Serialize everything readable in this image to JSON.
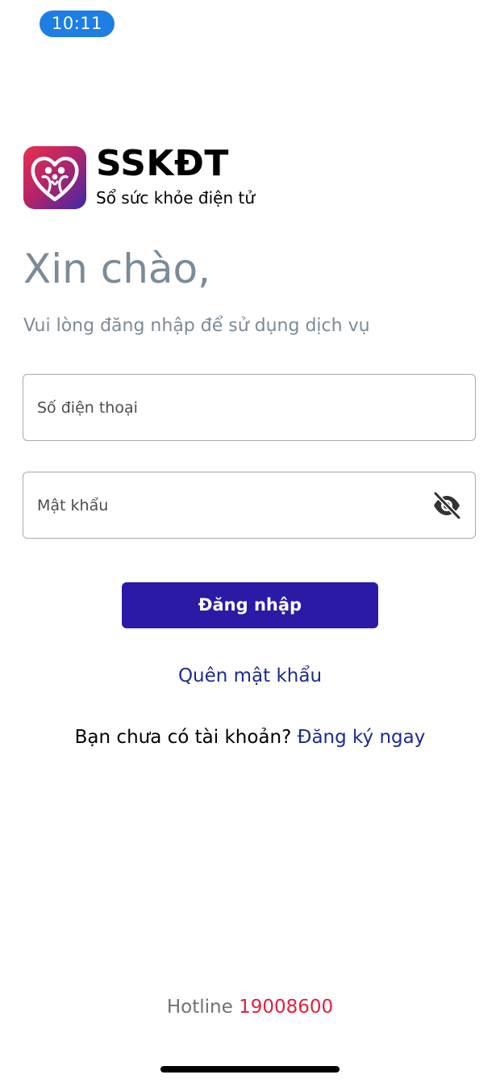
{
  "status_bar": {
    "time": "10:11",
    "pill_color": "#1f7ee3"
  },
  "brand": {
    "logo_icon": "heart-family-icon",
    "name": "SSKĐT",
    "subtitle": "Sổ sức khỏe điện tử",
    "gradient_colors": [
      "#e8304e",
      "#b0236b",
      "#3a2aa8"
    ]
  },
  "greeting": {
    "title": "Xin chào,",
    "subtitle": "Vui lòng đăng nhập để sử dụng dịch vụ"
  },
  "form": {
    "phone": {
      "placeholder": "Số điện thoại",
      "value": ""
    },
    "password": {
      "placeholder": "Mật khẩu",
      "value": "",
      "toggle_icon": "eye-off-icon"
    },
    "login_label": "Đăng nhập",
    "login_color": "#2a1aa6"
  },
  "links": {
    "forgot_password": "Quên mật khẩu",
    "no_account_prompt": "Bạn chưa có tài khoản?",
    "register": "Đăng ký ngay",
    "link_color": "#1e2a8e"
  },
  "footer": {
    "hotline_label": "Hotline",
    "hotline_number": "19008600",
    "hotline_color": "#e1203f"
  }
}
